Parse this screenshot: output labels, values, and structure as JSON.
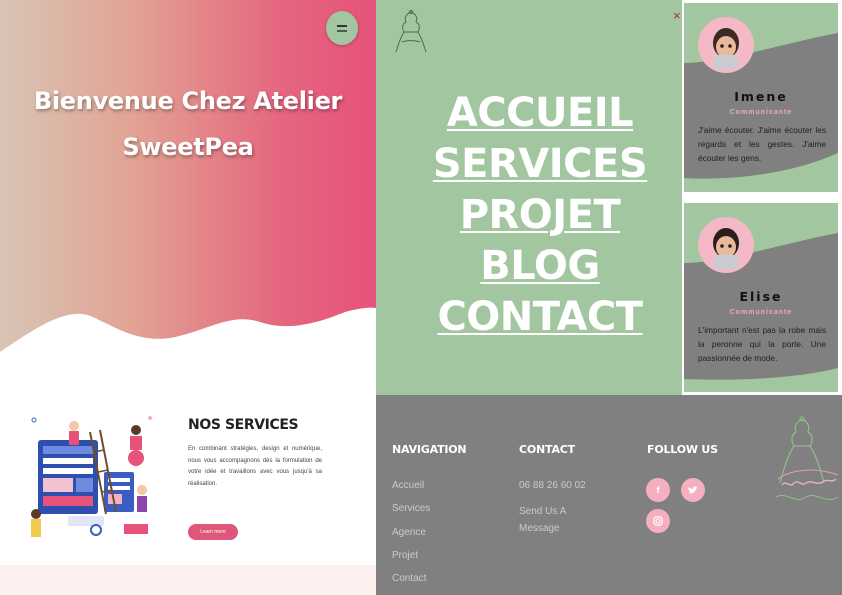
{
  "hero": {
    "title_line1": "Bienvenue Chez Atelier",
    "title_line2": "SweetPea"
  },
  "services": {
    "title": "NOS SERVICES",
    "description": "En combinant stratégies, design et numérique, nous vous accompagnons dès la formulation de votre idée et travaillons avec vous jusqu'à sa réalisation.",
    "button_label": "Learn more"
  },
  "menu": {
    "close_label": "×",
    "links": [
      "ACCUEIL",
      "SERVICES",
      "PROJET",
      "BLOG",
      "CONTACT"
    ]
  },
  "team": [
    {
      "name": "Imene",
      "role": "Communicante",
      "bio": "J'aime écouter. J'aime écouter les regards et les gestes. J'aime écouter les gens."
    },
    {
      "name": "Elise",
      "role": "Communicante",
      "bio": "L'important n'est pas la robe mais la peronne qui la porte. Une passionnée de mode."
    }
  ],
  "footer": {
    "navigation": {
      "heading": "NAVIGATION",
      "links": [
        "Accueil",
        "Services",
        "Agence",
        "Projet",
        "Contact"
      ]
    },
    "contact": {
      "heading": "CONTACT",
      "phone": "06 88 26 60 02",
      "message_line1": "Send Us A",
      "message_line2": "Message"
    },
    "follow": {
      "heading": "FOLLOW US",
      "icons": [
        "facebook-icon",
        "twitter-icon",
        "instagram-icon"
      ]
    }
  },
  "colors": {
    "pink": "#e6527a",
    "green": "#a2c69f",
    "grey": "#808080",
    "light_pink": "#f4b0c0"
  }
}
